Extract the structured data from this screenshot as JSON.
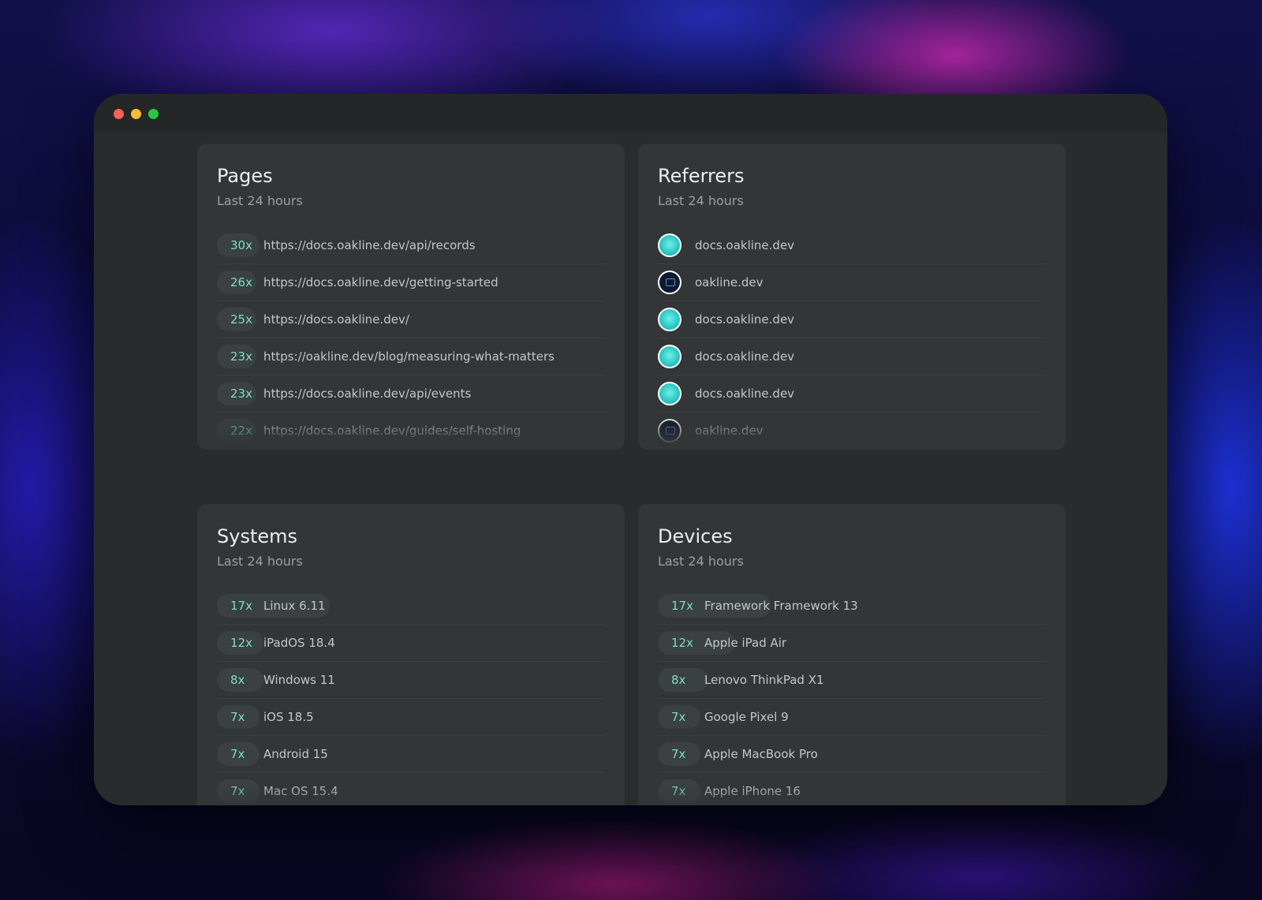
{
  "window": {
    "controls": [
      "close",
      "minimize",
      "maximize"
    ]
  },
  "pages": {
    "title": "Pages",
    "subtitle": "Last 24 hours",
    "rows": [
      {
        "count": "30x",
        "label": "https://docs.oakline.dev/api/records",
        "share": 0.11
      },
      {
        "count": "26x",
        "label": "https://docs.oakline.dev/getting-started",
        "share": 0.1
      },
      {
        "count": "25x",
        "label": "https://docs.oakline.dev/",
        "share": 0.1
      },
      {
        "count": "23x",
        "label": "https://oakline.dev/blog/measuring-what-matters",
        "share": 0.1
      },
      {
        "count": "23x",
        "label": "https://docs.oakline.dev/api/events",
        "share": 0.1
      },
      {
        "count": "22x",
        "label": "https://docs.oakline.dev/guides/self-hosting",
        "share": 0.1
      }
    ]
  },
  "referrers": {
    "title": "Referrers",
    "subtitle": "Last 24 hours",
    "rows": [
      {
        "icon": "docs-favicon-icon",
        "label": "docs.oakline.dev"
      },
      {
        "icon": "oakline-favicon-icon",
        "label": "oakline.dev"
      },
      {
        "icon": "docs-favicon-icon",
        "label": "docs.oakline.dev"
      },
      {
        "icon": "docs-favicon-icon",
        "label": "docs.oakline.dev"
      },
      {
        "icon": "docs-favicon-icon",
        "label": "docs.oakline.dev"
      },
      {
        "icon": "oakline-favicon-icon",
        "label": "oakline.dev"
      }
    ]
  },
  "systems": {
    "title": "Systems",
    "subtitle": "Last 24 hours",
    "rows": [
      {
        "count": "17x",
        "label": "Linux 6.11",
        "share": 0.29
      },
      {
        "count": "12x",
        "label": "iPadOS 18.4",
        "share": 0.12
      },
      {
        "count": "8x",
        "label": "Windows 11",
        "share": 0.12
      },
      {
        "count": "7x",
        "label": "iOS 18.5",
        "share": 0.11
      },
      {
        "count": "7x",
        "label": "Android 15",
        "share": 0.11
      },
      {
        "count": "7x",
        "label": "Mac OS 15.4",
        "share": 0.11
      }
    ]
  },
  "devices": {
    "title": "Devices",
    "subtitle": "Last 24 hours",
    "rows": [
      {
        "count": "17x",
        "label": "Framework Framework 13",
        "share": 0.29
      },
      {
        "count": "12x",
        "label": "Apple iPad Air",
        "share": 0.2
      },
      {
        "count": "8x",
        "label": "Lenovo ThinkPad X1",
        "share": 0.13
      },
      {
        "count": "7x",
        "label": "Google Pixel 9",
        "share": 0.11
      },
      {
        "count": "7x",
        "label": "Apple MacBook Pro",
        "share": 0.11
      },
      {
        "count": "7x",
        "label": "Apple iPhone 16",
        "share": 0.11
      }
    ]
  },
  "colors": {
    "count_text": "#78e0c4",
    "card_bg": "#323637",
    "window_bg": "#282c2d"
  }
}
